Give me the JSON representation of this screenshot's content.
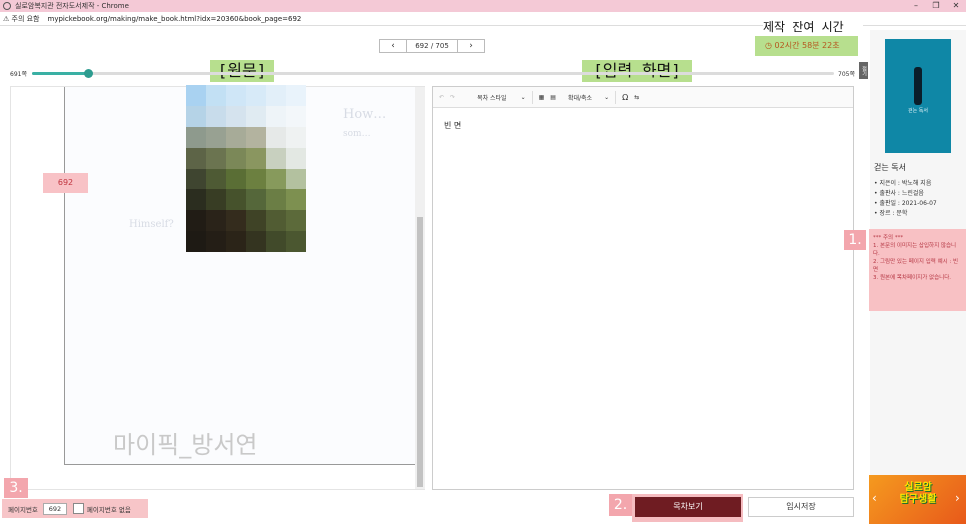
{
  "window": {
    "title": "실로암복지관 전자도서제작 - Chrome",
    "security_label": "주의 요함",
    "url": "mypickebook.org/making/make_book.html?idx=20360&book_page=692"
  },
  "annotations": {
    "timer_heading": "제작 잔여 시간",
    "original_label": "[원문]",
    "input_label": "[입력 화면]",
    "num1": "1.",
    "num2": "2.",
    "num3": "3."
  },
  "timer": {
    "value": "02시간 58분 22초"
  },
  "pager": {
    "prev": "‹",
    "next": "›",
    "current": "692",
    "total": "/ 705"
  },
  "slider": {
    "min_label": "691쪽",
    "max_label": "705쪽",
    "tab_label": "접기",
    "progress_fraction": 0.07
  },
  "viewer": {
    "page_badge": "692",
    "watermark": "마이픽_방서연",
    "ghost_lines": [
      "How…",
      "som…",
      "Himself?"
    ]
  },
  "editor": {
    "undo": "↶",
    "redo": "↷",
    "paragraph_style": "목차 스타일",
    "zoom": "확대/축소",
    "omega": "Ω",
    "content_text": "빈 면"
  },
  "book": {
    "title": "걷는 독서",
    "cover_title": "걷는 독서",
    "author": "• 지은이 : 박노해 지음",
    "publisher": "• 출판사 : 느린걸음",
    "date": "• 출판일 : 2021-06-07",
    "genre": "• 장르 : 문학"
  },
  "notice": {
    "heading": "*** 주의 ***",
    "line1": "1. 본문의 이미지는 삽입하지 않습니다.",
    "line2": "2. 그림만 있는 페이지 입력 예시 : 빈면",
    "line3": "3. 원본에 목차페이지가 없습니다."
  },
  "banner": {
    "line1": "실로암",
    "line2": "탐구생활"
  },
  "footer": {
    "page_number_label": "페이지번호",
    "page_number_value": "692",
    "no_page_number_label": "페이지번호 없음",
    "toc_button": "목차보기",
    "temp_save_button": "임시저장"
  },
  "colors": {
    "accent": "#3ab0a4",
    "toc_button": "#6f1c22",
    "annotation_pink": "#f3a6ad",
    "annotation_green": "#b7df8e"
  }
}
